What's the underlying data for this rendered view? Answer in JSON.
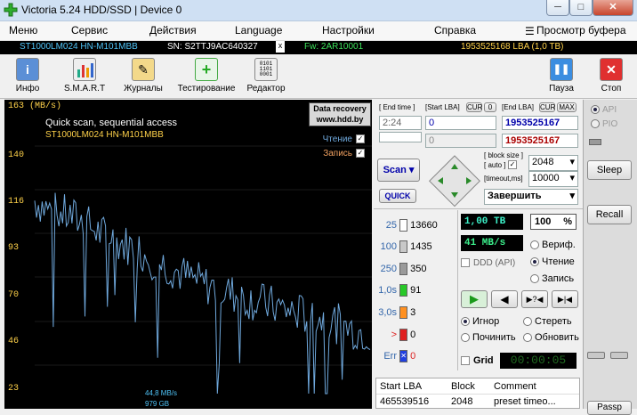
{
  "window": {
    "title": "Victoria 5.24 HDD/SSD | Device 0",
    "min": "─",
    "max": "□",
    "close": "✕"
  },
  "menu": [
    "Меню",
    "Сервис",
    "Действия",
    "Language",
    "Настройки",
    "Справка"
  ],
  "menu_right": "Просмотр буфера",
  "info": {
    "model": "ST1000LM024 HN-M101MBB",
    "serial": "SN: S2TTJ9AC640327",
    "close": "x",
    "fw": "Fw: 2AR10001",
    "lba": "1953525168 LBA (1,0 TB)"
  },
  "toolbar": [
    {
      "label": "Инфо",
      "icon": "info-icon"
    },
    {
      "label": "S.M.A.R.T",
      "icon": "smart-icon"
    },
    {
      "label": "Журналы",
      "icon": "logs-icon"
    },
    {
      "label": "Тестирование",
      "icon": "test-icon"
    },
    {
      "label": "Редактор",
      "icon": "editor-icon"
    }
  ],
  "toolbar_right": [
    {
      "label": "Пауза",
      "icon": "pause-icon"
    },
    {
      "label": "Стоп",
      "icon": "stop-icon"
    }
  ],
  "graph": {
    "ylabel": "163 (MB/s)",
    "yticks": [
      "140",
      "116",
      "93",
      "70",
      "46",
      "23"
    ],
    "title": "Quick scan, sequential access",
    "model": "ST1000LM024 HN-M101MBB",
    "logo_line1": "Data recovery",
    "logo_line2": "www.hdd.by",
    "legend_read": "Чтение",
    "legend_write": "Запись",
    "cursor_speed": "44,8 MB/s",
    "cursor_pos": "979 GB",
    "line_color": "#6fa8dc"
  },
  "chart_data": {
    "type": "line",
    "title": "Quick scan, sequential access",
    "ylabel": "163 (MB/s)",
    "ylim": [
      0,
      163
    ],
    "series": [
      {
        "name": "Чтение",
        "values": [
          110,
          104,
          102,
          98,
          92,
          88,
          85,
          79,
          75,
          70,
          66,
          63,
          60,
          57,
          55,
          52,
          50,
          48,
          45,
          42,
          40
        ]
      }
    ]
  },
  "scan": {
    "end_time_label": "[ End time ]",
    "end_time": "2:24",
    "start_lba_label": "[Start LBA]",
    "cur": "CUR",
    "zero": "0",
    "start_lba": "0",
    "start_lba2": "0",
    "end_lba_label": "[End LBA]",
    "max": "MAX",
    "end_lba": "1953525167",
    "end_lba2": "1953525167",
    "scan_btn": "Scan",
    "quick_btn": "QUICK",
    "block_size_label": "[ block size ]",
    "auto_label": "[ auto ]",
    "block_size": "2048",
    "timeout_label": "[timeout,ms]",
    "timeout": "10000",
    "finish": "Завершить"
  },
  "blocks": [
    {
      "label": "25",
      "count": "13660",
      "color": "#ffffff"
    },
    {
      "label": "100",
      "count": "1435",
      "color": "#c8c8c8"
    },
    {
      "label": "250",
      "count": "350",
      "color": "#9a9a9a"
    },
    {
      "label": "1,0s",
      "count": "91",
      "color": "#28c828"
    },
    {
      "label": "3,0s",
      "count": "3",
      "color": "#ff9020"
    },
    {
      "label": ">",
      "count": "0",
      "color": "#e02020"
    },
    {
      "label": "Err",
      "count": "0",
      "color": "#2040e0"
    }
  ],
  "status": {
    "size": "1,00 TB",
    "percent": "100",
    "percent_unit": "%",
    "speed": "41 MB/s",
    "ddd": "DDD (API)",
    "verify": "Вериф.",
    "read": "Чтение",
    "write": "Запись"
  },
  "actions": {
    "ignore": "Игнор",
    "erase": "Стереть",
    "fix": "Починить",
    "refresh": "Обновить"
  },
  "grid": {
    "label": "Grid",
    "timer": "00:00:05"
  },
  "table": {
    "headers": [
      "Start LBA",
      "Block",
      "Comment"
    ],
    "rows": [
      [
        "465539516",
        "2048",
        "preset timeo..."
      ]
    ]
  },
  "side": {
    "api": "API",
    "pio": "PIO",
    "sleep": "Sleep",
    "recall": "Recall",
    "passp": "Passp"
  }
}
